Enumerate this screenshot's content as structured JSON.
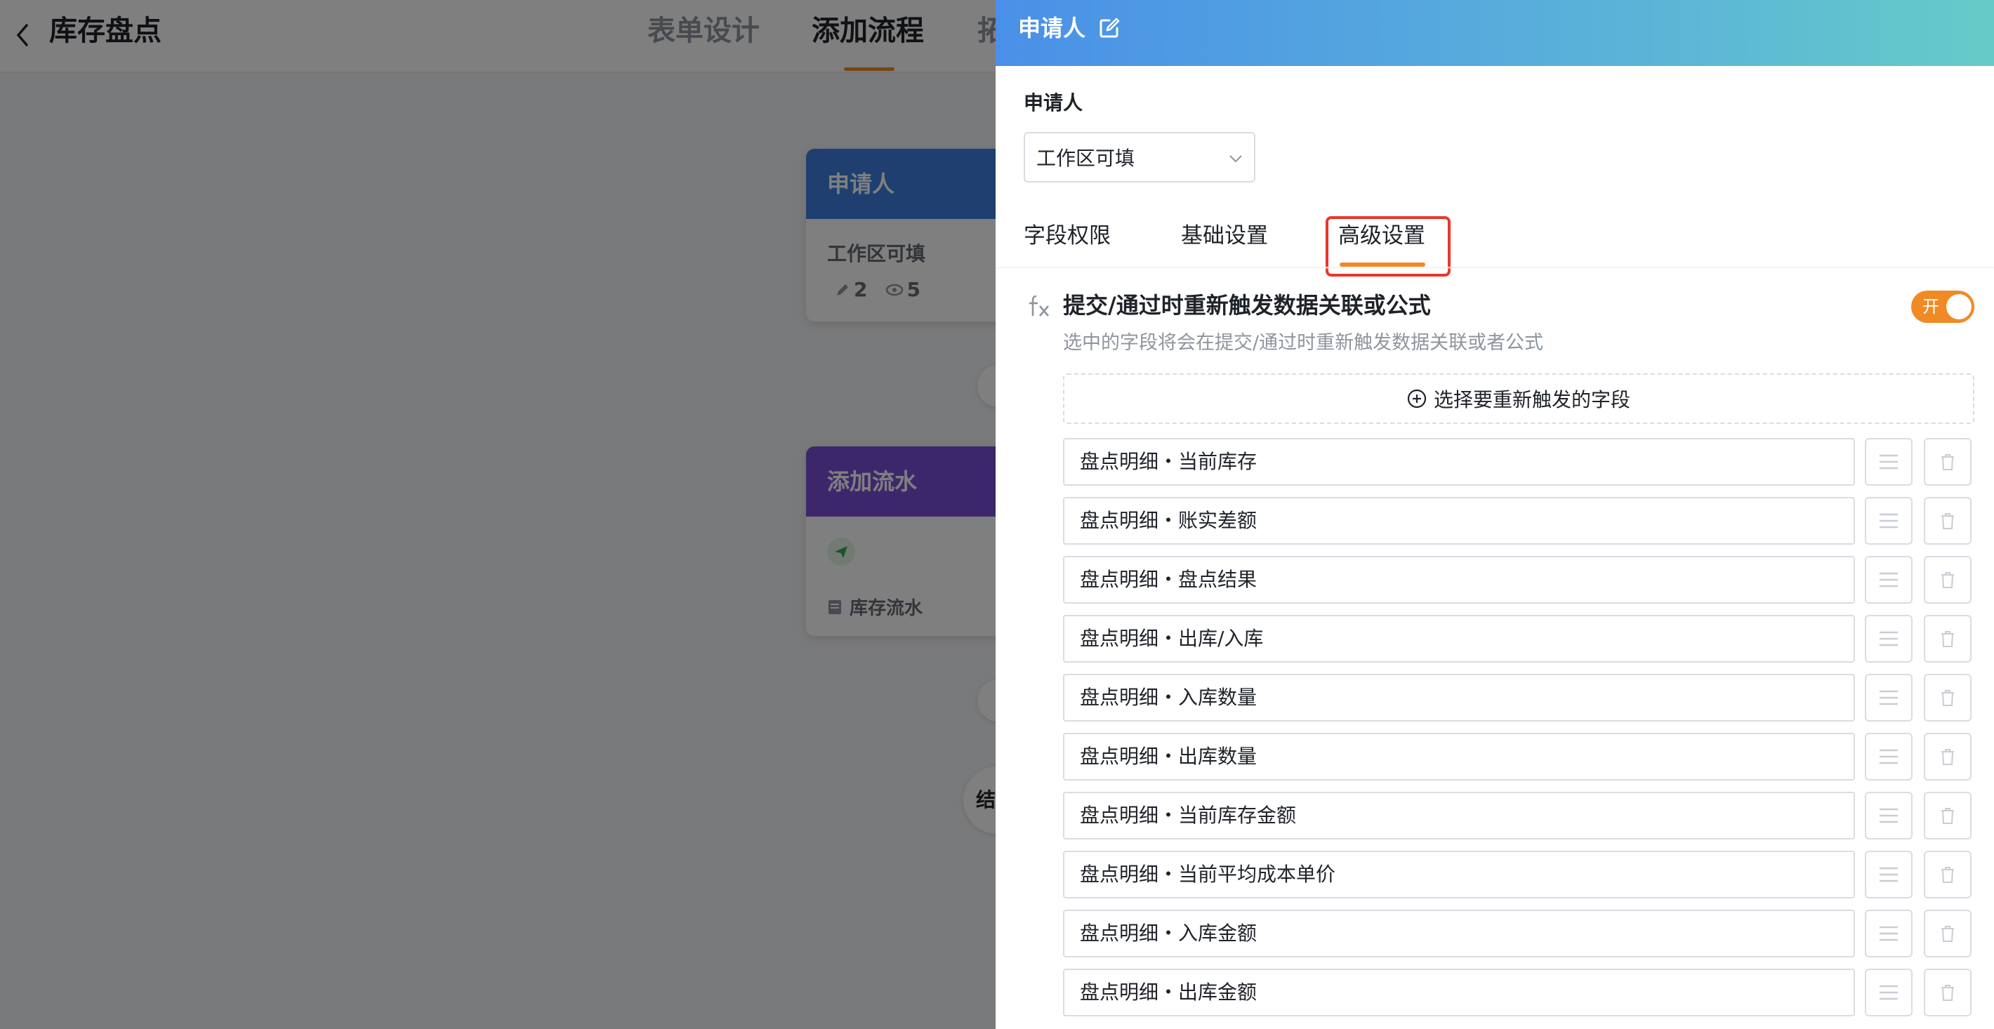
{
  "background": {
    "page_title": "库存盘点",
    "tabs": [
      "表单设计",
      "添加流程",
      "拓"
    ],
    "active_tab": "添加流程",
    "node_applicant": {
      "title": "申请人",
      "subtitle": "工作区可填",
      "edit_count": "2",
      "view_count": "5"
    },
    "node_flow": {
      "title": "添加流水",
      "item": "库存流水"
    },
    "end_node": "结"
  },
  "drawer": {
    "title": "申请人",
    "field_label": "申请人",
    "select_value": "工作区可填",
    "tabs": [
      "字段权限",
      "基础设置",
      "高级设置"
    ],
    "active_tab": "高级设置",
    "section": {
      "title": "提交/通过时重新触发数据关联或公式",
      "description": "选中的字段将会在提交/通过时重新触发数据关联或者公式",
      "toggle_label": "开",
      "toggle_on": true,
      "add_button": "选择要重新触发的字段"
    },
    "fields": [
      "盘点明细・当前库存",
      "盘点明细・账实差额",
      "盘点明细・盘点结果",
      "盘点明细・出库/入库",
      "盘点明细・入库数量",
      "盘点明细・出库数量",
      "盘点明细・当前库存金额",
      "盘点明细・当前平均成本单价",
      "盘点明细・入库金额",
      "盘点明细・出库金额"
    ]
  },
  "colors": {
    "accent": "#f08a24",
    "highlight_box": "#e8372b",
    "header_gradient_start": "#4a90e8",
    "header_gradient_end": "#66cbc8",
    "node_blue": "#3d7fe0",
    "node_purple": "#7b4fd9"
  },
  "icons": [
    "back-chevron-icon",
    "edit-icon",
    "chevron-down-icon",
    "fx-formula-icon",
    "plus-circle-icon",
    "drag-handle-icon",
    "trash-icon",
    "send-icon",
    "pencil-icon",
    "eye-icon",
    "table-icon"
  ]
}
